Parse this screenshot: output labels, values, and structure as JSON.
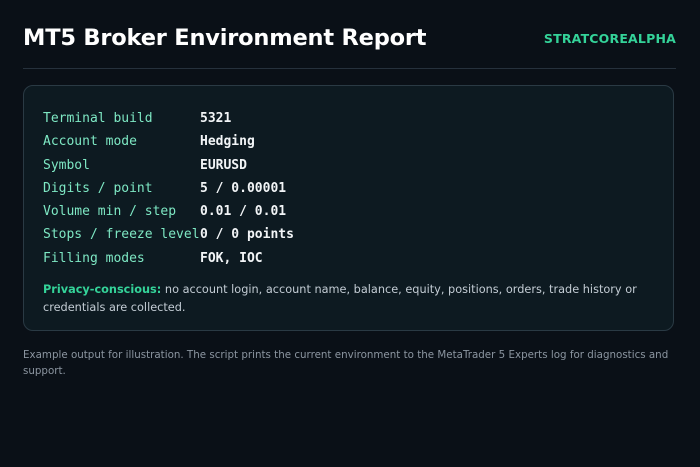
{
  "header": {
    "title": "MT5 Broker Environment Report",
    "brand": "STRATCOREALPHA"
  },
  "report": {
    "rows": [
      {
        "label": "Terminal build",
        "value": "5321"
      },
      {
        "label": "Account mode",
        "value": "Hedging"
      },
      {
        "label": "Symbol",
        "value": "EURUSD"
      },
      {
        "label": "Digits / point",
        "value": "5 / 0.00001"
      },
      {
        "label": "Volume min / step",
        "value": "0.01 / 0.01"
      },
      {
        "label": "Stops / freeze level",
        "value": "0 / 0 points"
      },
      {
        "label": "Filling modes",
        "value": "FOK, IOC"
      }
    ],
    "privacy_label": "Privacy-conscious:",
    "privacy_text": " no account login, account name, balance, equity, positions, orders, trade history or credentials are collected."
  },
  "footnote": "Example output for illustration. The script prints the current environment to the MetaTrader 5 Experts log for diagnostics and support."
}
